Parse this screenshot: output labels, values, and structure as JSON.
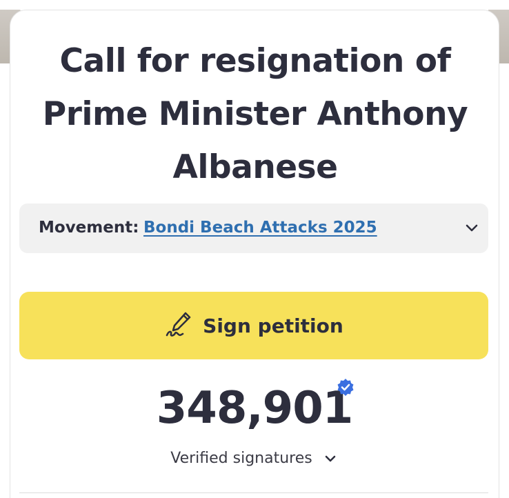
{
  "petition": {
    "title": "Call for resignation of Prime Minister Anthony Albanese"
  },
  "movement": {
    "label": "Movement:",
    "link_text": "Bondi Beach Attacks 2025"
  },
  "sign_button": {
    "label": "Sign petition",
    "icon": "pen-signature-icon"
  },
  "signatures": {
    "count": "348,901",
    "verified_label": "Verified signatures",
    "badge_icon": "verified-badge-icon"
  },
  "colors": {
    "accent_yellow": "#f7e15a",
    "link_blue": "#2f6fb0",
    "text_dark": "#2d2e3d",
    "badge_blue": "#3b6fe0",
    "panel_gray": "#f1f1f1"
  }
}
